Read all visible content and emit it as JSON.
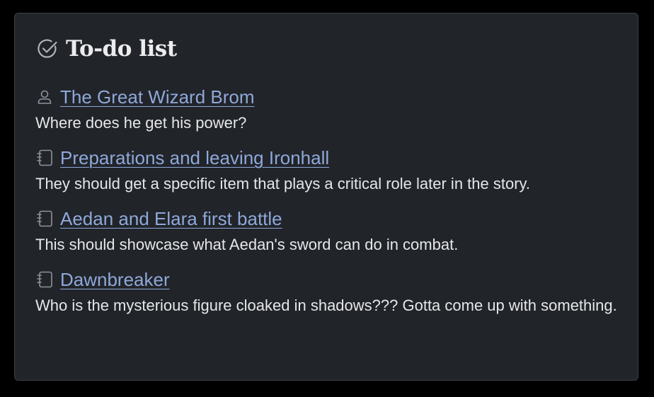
{
  "panel": {
    "title": "To-do list",
    "title_icon": "check-circle-icon"
  },
  "items": [
    {
      "icon": "person-icon",
      "link": "The Great Wizard Brom",
      "note": "Where does he get his power?"
    },
    {
      "icon": "notebook-icon",
      "link": "Preparations and leaving Ironhall",
      "note": "They should get a specific item that plays a critical role later in the story."
    },
    {
      "icon": "notebook-icon",
      "link": "Aedan and Elara first battle",
      "note": "This should showcase what Aedan's sword can do in combat."
    },
    {
      "icon": "notebook-icon",
      "link": "Dawnbreaker",
      "note": "Who is the mysterious figure cloaked in shadows??? Gotta come up with something."
    }
  ],
  "colors": {
    "background": "#000000",
    "card": "#212429",
    "link": "#8fa8d9",
    "text": "#e6e7e9",
    "icon": "#9aa0a8"
  }
}
